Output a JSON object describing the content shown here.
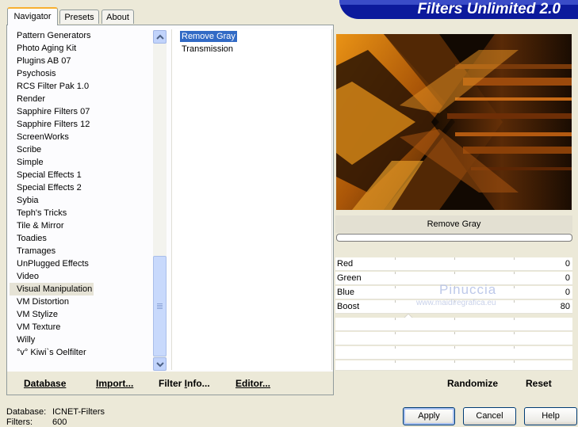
{
  "window": {
    "title": "Filters Unlimited 2.0"
  },
  "tabs": [
    {
      "label": "Navigator",
      "active": true
    },
    {
      "label": "Presets",
      "active": false
    },
    {
      "label": "About",
      "active": false
    }
  ],
  "categories": [
    "Pattern Generators",
    "Photo Aging Kit",
    "Plugins AB 07",
    "Psychosis",
    "RCS Filter Pak 1.0",
    "Render",
    "Sapphire Filters 07",
    "Sapphire Filters 12",
    "ScreenWorks",
    "Scribe",
    "Simple",
    "Special Effects 1",
    "Special Effects 2",
    "Sybia",
    "Teph's Tricks",
    "Tile & Mirror",
    "Toadies",
    "Tramages",
    "UnPlugged Effects",
    "Video",
    "Visual Manipulation",
    "VM Distortion",
    "VM Stylize",
    "VM Texture",
    "Willy",
    "°v° Kiwi`s Oelfilter"
  ],
  "selected_category": "Visual Manipulation",
  "filters": [
    {
      "label": "Remove Gray",
      "selected": true
    },
    {
      "label": "Transmission",
      "selected": false
    }
  ],
  "left_buttons": {
    "database_pre": "D",
    "database_post": "atabase",
    "import_pre": "I",
    "import_post": "mport...",
    "filterinfo_pre": "Filter ",
    "filterinfo_u": "I",
    "filterinfo_post": "nfo...",
    "editor_pre": "E",
    "editor_post": "ditor..."
  },
  "preview": {
    "filter_name": "Remove Gray"
  },
  "progress": 0,
  "sliders": [
    {
      "name": "Red",
      "value": 0
    },
    {
      "name": "Green",
      "value": 0
    },
    {
      "name": "Blue",
      "value": 0
    },
    {
      "name": "Boost",
      "value": 80
    }
  ],
  "right_buttons": {
    "randomize": "Randomize",
    "reset": "Reset"
  },
  "watermark": {
    "name": "Pinuccia",
    "site": "www.maidiregrafica.eu"
  },
  "status": {
    "database_label": "Database:",
    "database_value": "ICNET-Filters",
    "filters_label": "Filters:",
    "filters_value": "600"
  },
  "dialog_buttons": {
    "apply": "Apply",
    "cancel": "Cancel",
    "help": "Help"
  },
  "colors": {
    "banner": "#0c1a9c",
    "selection": "#316ac5",
    "tab_accent": "#f8b030"
  }
}
